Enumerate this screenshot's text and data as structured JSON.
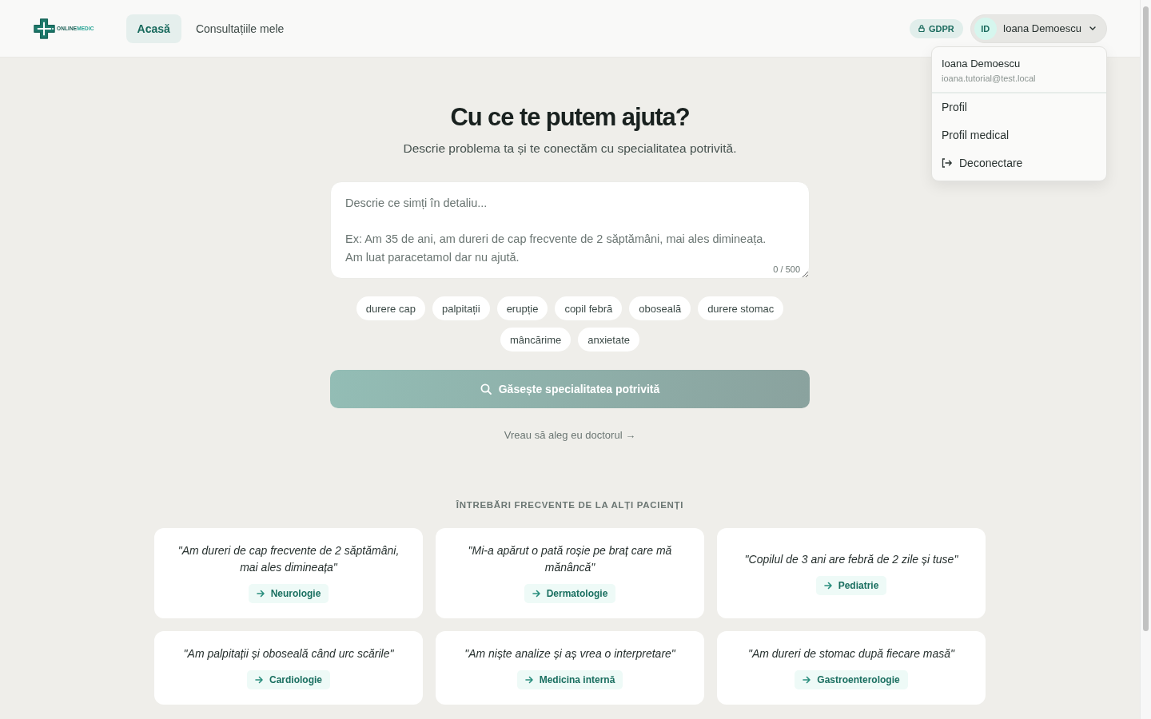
{
  "header": {
    "logo": {
      "parts": [
        "ONLINE",
        "MEDIC"
      ]
    },
    "nav": [
      {
        "label": "Acasă",
        "selected": true
      },
      {
        "label": "Consultațiile mele",
        "selected": false
      }
    ],
    "gdpr_badge": "GDPR",
    "user_menu": {
      "initials": "ID",
      "name": "Ioana Demoescu",
      "expanded": true
    }
  },
  "dropdown": {
    "name": "Ioana Demoescu",
    "email": "ioana.tutorial@test.local",
    "items": [
      {
        "label": "Profil",
        "kind": "link"
      },
      {
        "label": "Profil medical",
        "kind": "link"
      },
      {
        "label": "Deconectare",
        "kind": "logout"
      }
    ]
  },
  "hero": {
    "title": "Cu ce te putem ajuta?",
    "subtitle": "Descrie problema ta și te conectăm cu specialitatea potrivită."
  },
  "symptom_field": {
    "placeholder": "Descrie ce simți în detaliu...\n\nEx: Am 35 de ani, am dureri de cap frecvente de 2 săptămâni, mai ales dimineața. Am luat paracetamol dar nu ajută.",
    "counter": "0 / 500"
  },
  "chips": [
    "durere cap",
    "palpitații",
    "erupție",
    "copil febră",
    "oboseală",
    "durere stomac",
    "mâncărime",
    "anxietate"
  ],
  "search_button": {
    "label": "Găsește specialitatea potrivită",
    "disabled": true
  },
  "doctor_link": "Vreau să aleg eu doctorul →",
  "faq": {
    "heading": "ÎNTREBĂRI FRECVENTE DE LA ALȚI PACIENȚI",
    "cards": [
      {
        "quote": "\"Am dureri de cap frecvente de 2 săptămâni, mai ales dimineața\"",
        "specialty": "Neurologie"
      },
      {
        "quote": "\"Mi-a apărut o pată roșie pe braț care mă mănâncă\"",
        "specialty": "Dermatologie"
      },
      {
        "quote": "\"Copilul de 3 ani are febră de 2 zile și tuse\"",
        "specialty": "Pediatrie"
      },
      {
        "quote": "\"Am palpitații și oboseală când urc scările\"",
        "specialty": "Cardiologie"
      },
      {
        "quote": "\"Am niște analize și aș vrea o interpretare\"",
        "specialty": "Medicina internă"
      },
      {
        "quote": "\"Am dureri de stomac după fiecare masă\"",
        "specialty": "Gastroenterologie"
      }
    ]
  }
}
